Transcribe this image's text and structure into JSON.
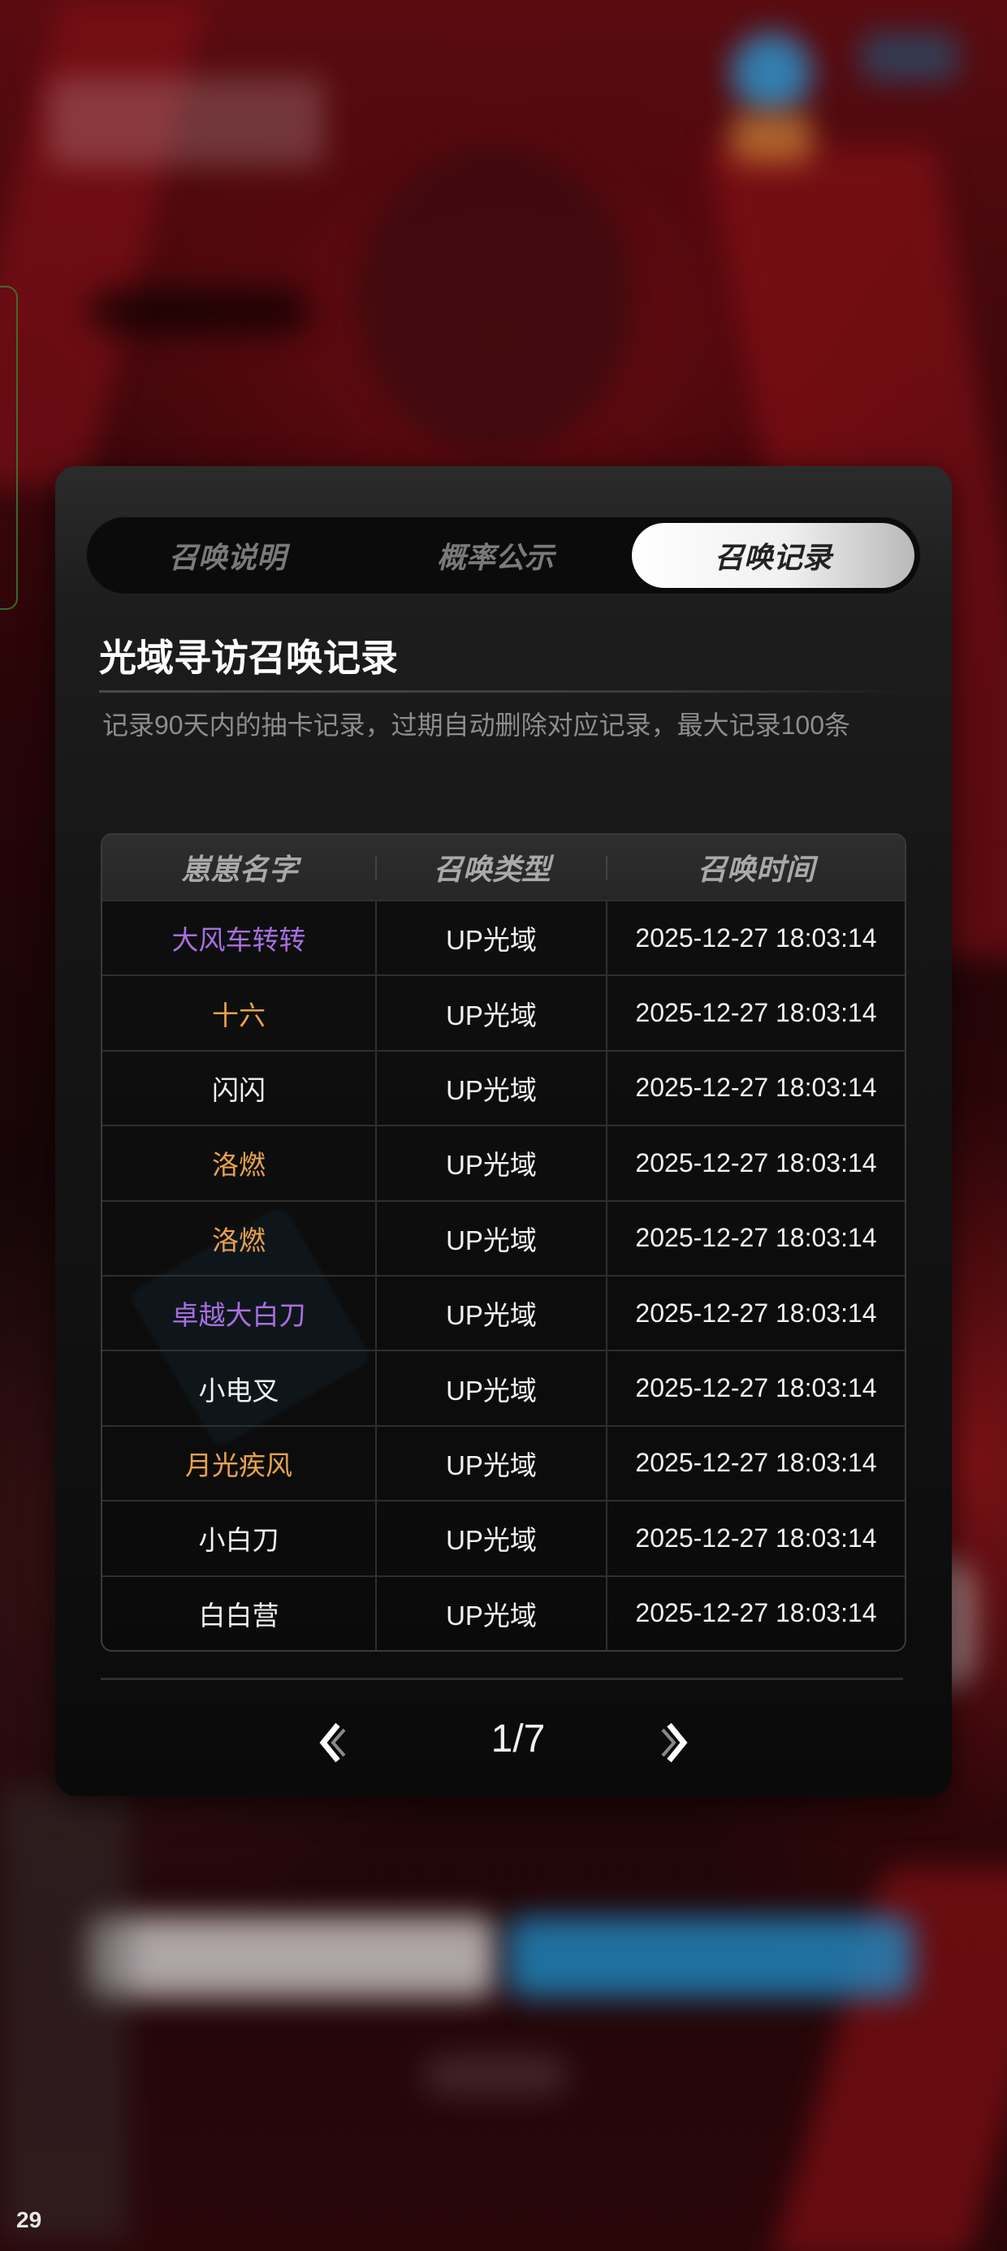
{
  "device": {
    "corner_number": "29"
  },
  "tabs": [
    {
      "label": "召唤说明",
      "active": false
    },
    {
      "label": "概率公示",
      "active": false
    },
    {
      "label": "召唤记录",
      "active": true
    }
  ],
  "record": {
    "title": "光域寻访召唤记录",
    "subtitle": "记录90天内的抽卡记录，过期自动删除对应记录，最大记录100条"
  },
  "table": {
    "headers": [
      "崽崽名字",
      "召唤类型",
      "召唤时间"
    ],
    "rows": [
      {
        "name": "大风车转转",
        "type": "UP光域",
        "time": "2025-12-27 18:03:14",
        "rarity_color": "#a76fe0"
      },
      {
        "name": "十六",
        "type": "UP光域",
        "time": "2025-12-27 18:03:14",
        "rarity_color": "#e9a24a"
      },
      {
        "name": "闪闪",
        "type": "UP光域",
        "time": "2025-12-27 18:03:14",
        "rarity_color": "#f2f2f2"
      },
      {
        "name": "洛燃",
        "type": "UP光域",
        "time": "2025-12-27 18:03:14",
        "rarity_color": "#e9a24a"
      },
      {
        "name": "洛燃",
        "type": "UP光域",
        "time": "2025-12-27 18:03:14",
        "rarity_color": "#e9a24a"
      },
      {
        "name": "卓越大白刀",
        "type": "UP光域",
        "time": "2025-12-27 18:03:14",
        "rarity_color": "#a76fe0"
      },
      {
        "name": "小电叉",
        "type": "UP光域",
        "time": "2025-12-27 18:03:14",
        "rarity_color": "#f2f2f2"
      },
      {
        "name": "月光疾风",
        "type": "UP光域",
        "time": "2025-12-27 18:03:14",
        "rarity_color": "#e9a24a"
      },
      {
        "name": "小白刀",
        "type": "UP光域",
        "time": "2025-12-27 18:03:14",
        "rarity_color": "#f2f2f2"
      },
      {
        "name": "白白营",
        "type": "UP光域",
        "time": "2025-12-27 18:03:14",
        "rarity_color": "#f2f2f2"
      }
    ]
  },
  "pagination": {
    "text": "1/7",
    "prev_icon": "chevron-left-icon",
    "next_icon": "chevron-right-icon"
  }
}
